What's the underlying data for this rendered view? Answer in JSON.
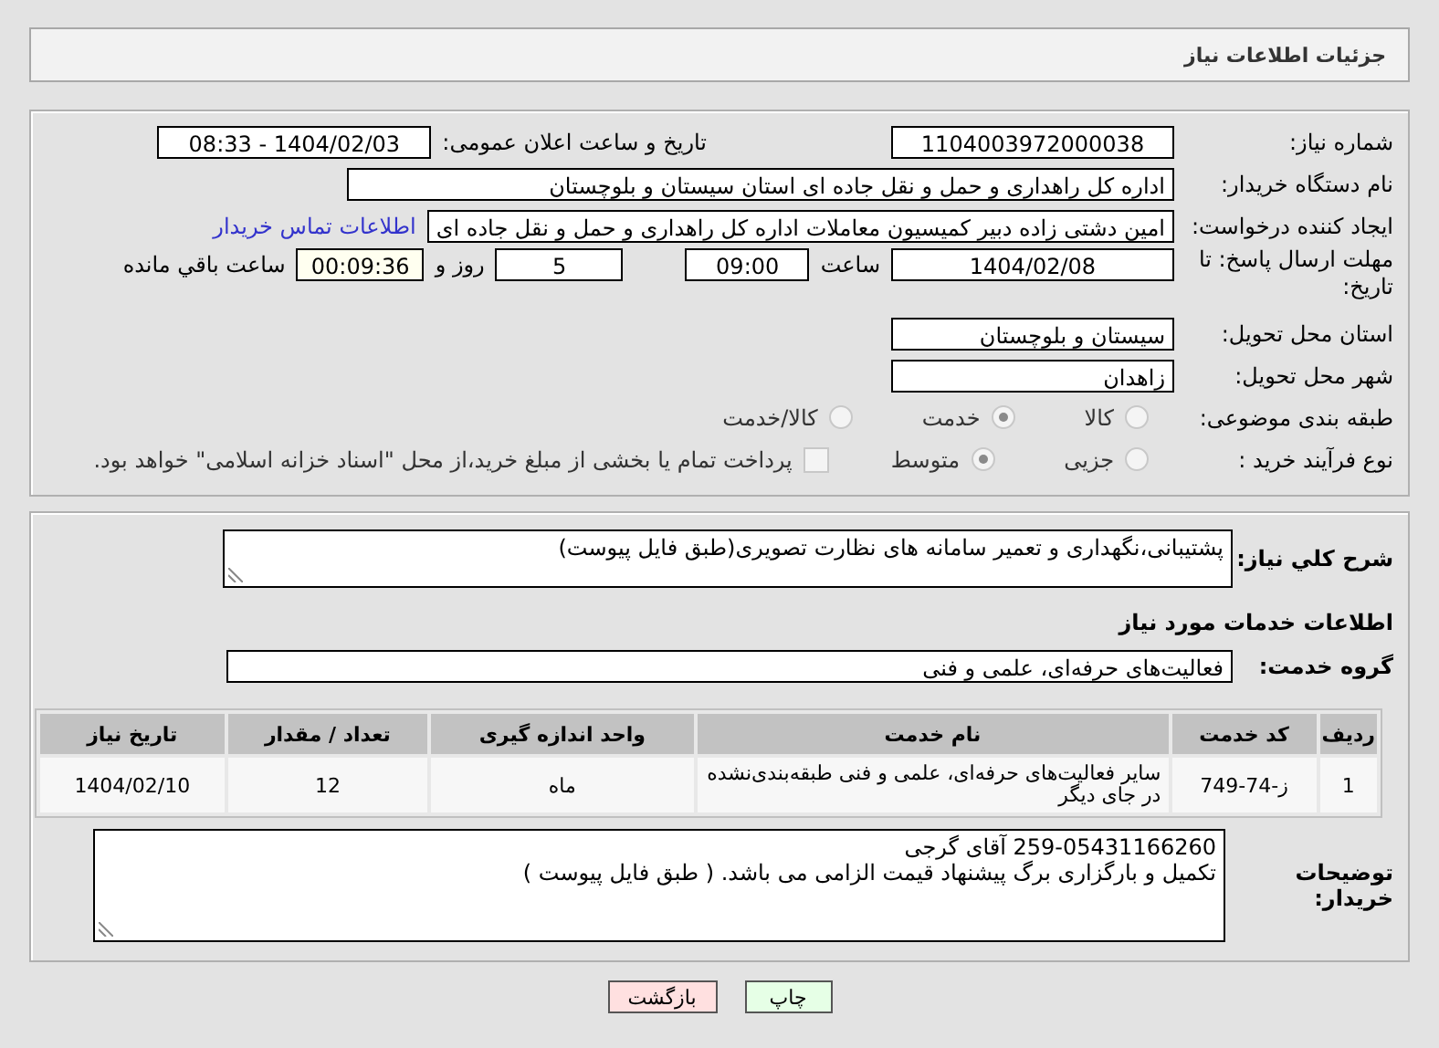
{
  "header": {
    "title": "جزئیات اطلاعات نیاز"
  },
  "need_number": {
    "label": "شماره نیاز:",
    "value": "1104003972000038"
  },
  "announce": {
    "label": "تاریخ و ساعت اعلان عمومی:",
    "value": "1404/02/03 - 08:33"
  },
  "buyer_org": {
    "label": "نام دستگاه خریدار:",
    "value": "اداره کل راهداری و حمل و نقل جاده ای استان سیستان و بلوچستان"
  },
  "requester": {
    "label": "ایجاد کننده درخواست:",
    "value": "امین دشتی زاده دبیر کمیسیون معاملات اداره کل راهداری و حمل و نقل جاده ای",
    "link": "اطلاعات تماس خریدار"
  },
  "deadline": {
    "label": "مهلت ارسال پاسخ: تا تاریخ:",
    "date": "1404/02/08",
    "time_label": "ساعت",
    "time": "09:00",
    "days": "5",
    "days_label": "روز و",
    "remaining": "00:09:36",
    "remaining_label": "ساعت باقي مانده"
  },
  "province": {
    "label": "استان محل تحویل:",
    "value": "سیستان و بلوچستان"
  },
  "city": {
    "label": "شهر محل تحویل:",
    "value": "زاهدان"
  },
  "category": {
    "label": "طبقه بندی موضوعی:",
    "options": [
      {
        "label": "کالا",
        "selected": false
      },
      {
        "label": "خدمت",
        "selected": true
      },
      {
        "label": "کالا/خدمت",
        "selected": false
      }
    ]
  },
  "process": {
    "label": "نوع فرآیند خرید :",
    "options": [
      {
        "label": "جزیی",
        "selected": false
      },
      {
        "label": "متوسط",
        "selected": true
      }
    ],
    "treasury": {
      "label": "پرداخت تمام یا بخشی از مبلغ خرید،از محل \"اسناد خزانه اسلامی\" خواهد بود.",
      "checked": false
    }
  },
  "description": {
    "label": "شرح کلي نیاز:",
    "value": "پشتیبانی،نگهداری و تعمیر سامانه های نظارت تصویری(طبق فایل پیوست)"
  },
  "services_heading": "اطلاعات خدمات مورد نیاز",
  "service_group": {
    "label": "گروه خدمت:",
    "value": "فعالیت‌های حرفه‌ای، علمی و فنی"
  },
  "table": {
    "columns": [
      "ردیف",
      "کد خدمت",
      "نام خدمت",
      "واحد اندازه گیری",
      "تعداد / مقدار",
      "تاریخ نیاز"
    ],
    "rows": [
      [
        "1",
        "ز-74-749",
        "سایر فعالیت‌های حرفه‌ای، علمی و فنی طبقه‌بندی‌نشده در جای دیگر",
        "ماه",
        "12",
        "1404/02/10"
      ]
    ]
  },
  "buyer_notes": {
    "label": "توضیحات خریدار:",
    "lines": [
      "259-05431166260 آقای گرجی",
      "تکمیل و بارگزاری برگ پیشنهاد قیمت الزامی می باشد. ( طبق فایل پیوست )"
    ]
  },
  "buttons": [
    {
      "label": "چاپ",
      "kind": "print"
    },
    {
      "label": "بازگشت",
      "kind": "back"
    }
  ]
}
